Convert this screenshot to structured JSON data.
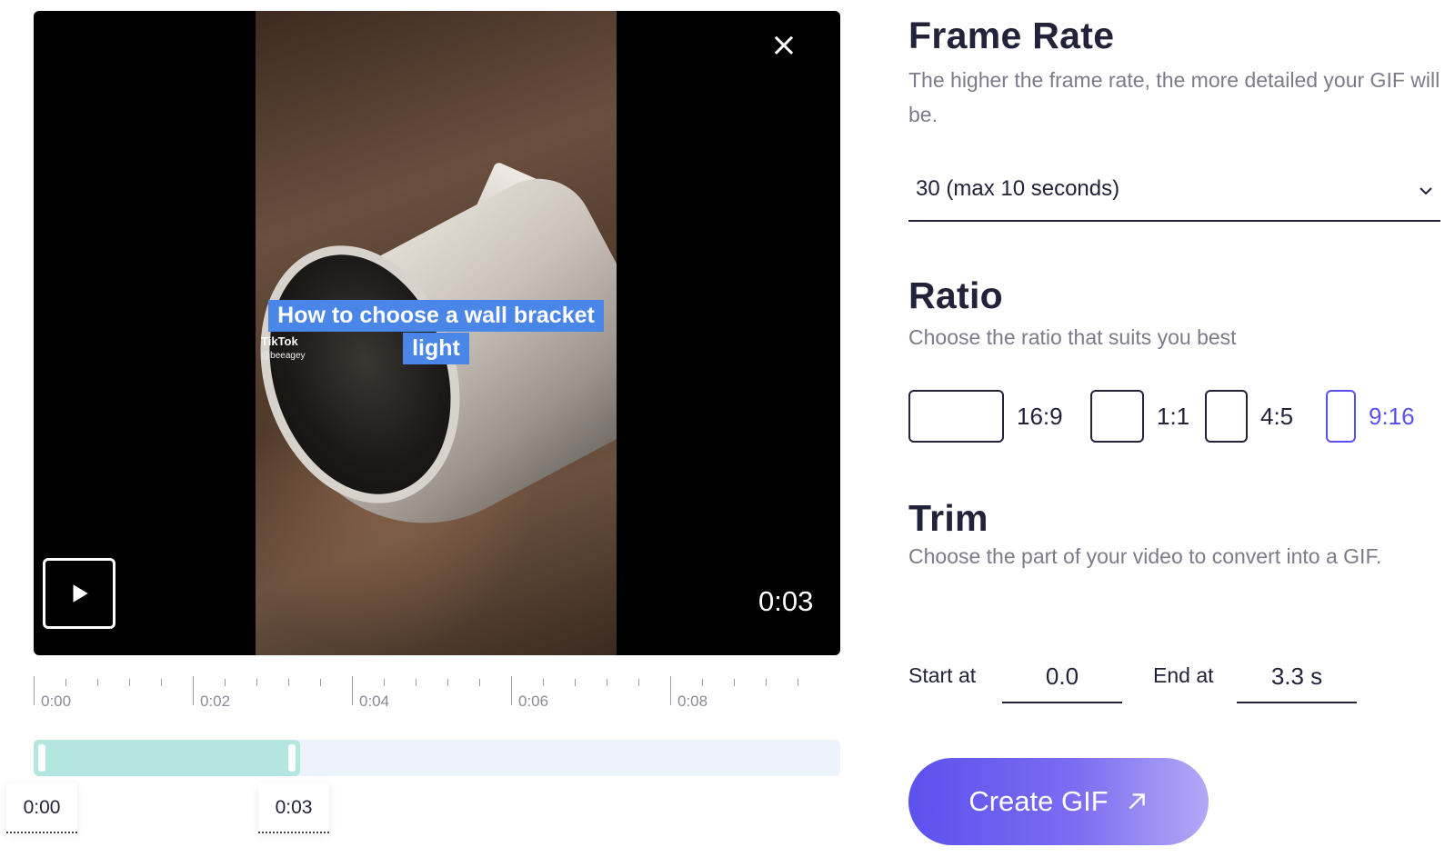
{
  "player": {
    "caption_line1": "How to choose a wall bracket",
    "caption_line2": "light",
    "watermark_brand": "TikTok",
    "watermark_user": "@beeagey",
    "time_display": "0:03"
  },
  "timeline": {
    "tick_labels": [
      "0:00",
      "0:02",
      "0:04",
      "0:06",
      "0:08"
    ],
    "selection_fraction": 0.33,
    "start_tag": "0:00",
    "end_tag": "0:03"
  },
  "frame_rate": {
    "title": "Frame Rate",
    "description": "The higher the frame rate, the more detailed your GIF will be.",
    "selected": "30 (max 10 seconds)"
  },
  "ratio": {
    "title": "Ratio",
    "description": "Choose the ratio that suits you best",
    "options": [
      {
        "label": "16:9"
      },
      {
        "label": "1:1"
      },
      {
        "label": "4:5"
      },
      {
        "label": "9:16",
        "selected": true
      }
    ]
  },
  "trim": {
    "title": "Trim",
    "description": "Choose the part of your video to convert into a GIF.",
    "start_label": "Start at",
    "start_value": "0.0",
    "end_label": "End at",
    "end_value": "3.3 s"
  },
  "create_button": "Create GIF",
  "colors": {
    "accent": "#5a4ff0",
    "selection": "#b4e6e0",
    "track": "#ecf3fb"
  }
}
